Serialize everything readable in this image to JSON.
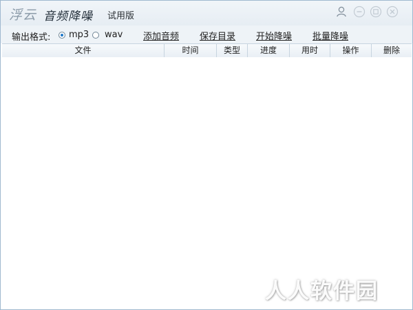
{
  "app": {
    "brand_part1": "浮云",
    "brand_part2": "音频降噪",
    "edition": "试用版"
  },
  "title_controls": {
    "user_icon": "user-icon",
    "minimize_icon": "minimize-icon",
    "restore_icon": "restore-icon",
    "close_icon": "close-icon"
  },
  "toolbar": {
    "format_label": "输出格式:",
    "formats": [
      {
        "label": "mp3",
        "selected": true
      },
      {
        "label": "wav",
        "selected": false
      }
    ],
    "actions": [
      "添加音频",
      "保存目录",
      "开始降噪",
      "批量降噪"
    ]
  },
  "table": {
    "columns": [
      "文件",
      "时间",
      "类型",
      "进度",
      "用时",
      "操作",
      "删除"
    ],
    "rows": []
  },
  "watermark": "人人软件园",
  "colors": {
    "titlebar": "#e9eff4",
    "toolbar": "#eef3f7",
    "border": "#9fb8cf",
    "radio_selected": "#1e78c8"
  }
}
